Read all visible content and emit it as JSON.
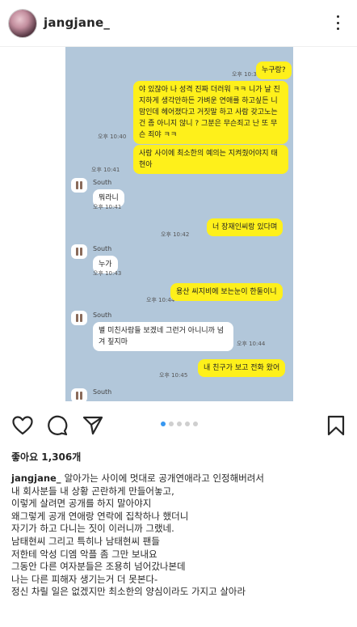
{
  "header": {
    "username": "jangjane_"
  },
  "chat": {
    "messages": [
      {
        "id": "m1",
        "side": "me",
        "text": "누구랑?",
        "time": "오후 10:34"
      },
      {
        "id": "m2",
        "side": "me",
        "text": "야 있잖아 나 성격 진짜 더러워 ㅋㅋ 니가 날 진지하게 생각안하든 가벼운 연애를 하고싶든 니 맘인데  헤어졌다고 거짓말 하고 사람 갖고노는건 좀 아니지 않니 ? 그분은 무슨죄고 난 또 무슨 죄야 ㅋㅋ",
        "time": "오후 10:40"
      },
      {
        "id": "m3",
        "side": "me",
        "text": "사람 사이에 최소한의 예의는 지켜줬어야지 태현아",
        "time": "오후 10:41"
      },
      {
        "id": "m4",
        "side": "other",
        "sender": "South",
        "text": "뭐라니",
        "time": "오후 10:41"
      },
      {
        "id": "m5",
        "side": "me",
        "text": "너 장재인씨랑 있다며",
        "time": "오후 10:42"
      },
      {
        "id": "m6",
        "side": "other",
        "sender": "South",
        "text": "누가",
        "time": "오후 10:43"
      },
      {
        "id": "m7",
        "side": "me",
        "text": "용산 씨지비에 보는눈이 한둘이니",
        "time": "오후 10:44"
      },
      {
        "id": "m8",
        "side": "other",
        "sender": "South",
        "text": "별 미친사람들 보겠네 그런거 아니니까 넘겨 짚지마",
        "time": "오후 10:44"
      },
      {
        "id": "m9",
        "side": "me",
        "text": "내 친구가 보고 전화 왔어",
        "time": "오후 10:45"
      },
      {
        "id": "m10",
        "side": "other",
        "sender": "South",
        "text": "",
        "time": ""
      }
    ]
  },
  "carousel": {
    "count": 5,
    "active": 0
  },
  "likes": {
    "label": "좋아요 1,306개"
  },
  "caption": {
    "username": "jangjane_",
    "lines": [
      "알아가는 사이에 멋대로 공개연애라고 인정해버려서",
      "내 회사분들 내 상황 곤란하게 만들어놓고,",
      "이렇게 살려면 공개를 하지 말아야지",
      "왜그렇게 공개 연애랑 연락에 집착하나 했더니",
      "자기가 하고 다니는 짓이 이러니까 그랬네.",
      "남태현씨 그리고 특히나 남태현씨 팬들",
      "저한테 악성 디엠 악플 좀 그만 보내요",
      "그동안 다른 여자분들은 조용히 넘어갔나본데",
      "나는 다른 피해자 생기는거 더 못본다-",
      "정신 차릴 일은 없겠지만 최소한의 양심이라도 가지고 살아라"
    ]
  },
  "colors": {
    "chat_bg": "#b2c7da",
    "my_bubble": "#fef01b",
    "active_dot": "#3897f0"
  },
  "icons": [
    "more-icon",
    "heart-icon",
    "comment-icon",
    "share-icon",
    "bookmark-icon"
  ]
}
